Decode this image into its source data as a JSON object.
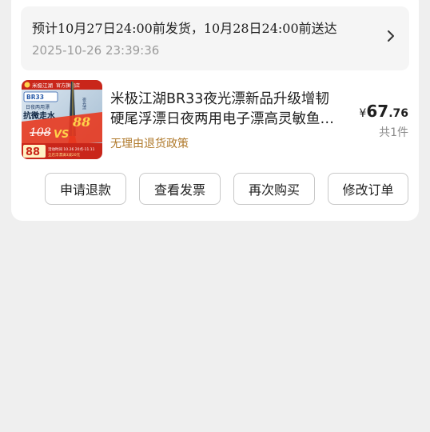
{
  "shipping": {
    "text": "预计10月27日24:00前发货，10月28日24:00前送达",
    "order_time": "2025-10-26 23:39:36",
    "chevron_icon": "chevron-right-icon"
  },
  "product": {
    "title_line1": "米极江湖BR33夜光漂新品升级增韧",
    "title_line2": "硬尾浮漂日夜两用电子漂高灵敏鱼…",
    "policy": "无理由退货政策",
    "price_currency": "¥",
    "price_int": "67",
    "price_dec": ".76",
    "quantity": "共1件",
    "image": {
      "brand": "米极江湖",
      "store": "官方旗舰店",
      "model": "BR33",
      "subtitle": "日夜两用漂",
      "slogan": "抗微走水",
      "old_price": "108",
      "new_price": "88",
      "vs": "VS",
      "deal_price": "88",
      "promo": "活动时间 10.26 20点-11.11",
      "coupon": "全店浮漂满3减20元",
      "accent_color": "#e8391f"
    }
  },
  "actions": {
    "refund": "申请退款",
    "invoice": "查看发票",
    "rebuy": "再次购买",
    "modify": "修改订单"
  }
}
